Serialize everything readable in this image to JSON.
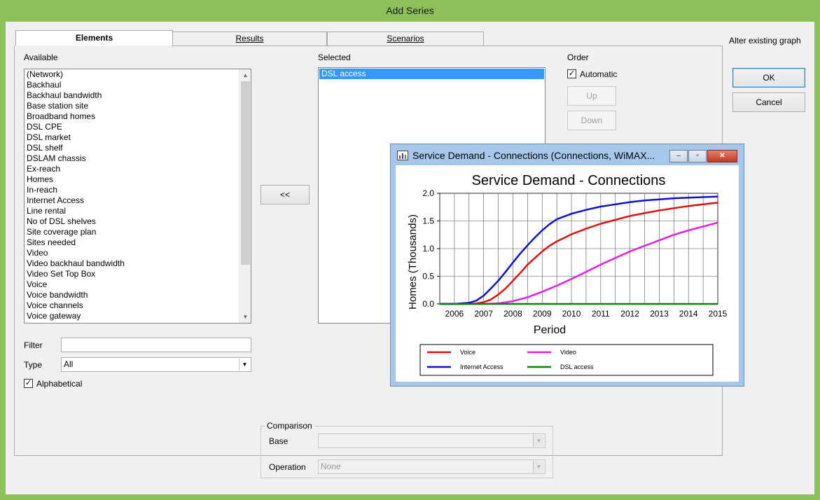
{
  "window": {
    "title": "Add Series"
  },
  "tabs": [
    {
      "label": "Elements",
      "active": true
    },
    {
      "label": "Results",
      "active": false
    },
    {
      "label": "Scenarios",
      "active": false
    }
  ],
  "alter_label": "Alter existing graph",
  "available": {
    "label": "Available",
    "items": [
      "(Network)",
      "Backhaul",
      "Backhaul bandwidth",
      "Base station site",
      "Broadband homes",
      "DSL CPE",
      "DSL market",
      "DSL shelf",
      "DSLAM chassis",
      "Ex-reach",
      "Homes",
      "In-reach",
      "Internet Access",
      "Line rental",
      "No of DSL shelves",
      "Site coverage plan",
      "Sites needed",
      "Video",
      "Video backhaul bandwidth",
      "Video Set Top Box",
      "Voice",
      "Voice bandwidth",
      "Voice channels",
      "Voice gateway"
    ]
  },
  "selected": {
    "label": "Selected",
    "items": [
      "DSL access"
    ]
  },
  "order": {
    "label": "Order",
    "automatic_label": "Automatic",
    "automatic_checked": true,
    "up_label": "Up",
    "down_label": "Down"
  },
  "move_button": {
    "label": "<<"
  },
  "buttons": {
    "ok": "OK",
    "cancel": "Cancel"
  },
  "filter": {
    "label": "Filter",
    "value": ""
  },
  "type": {
    "label": "Type",
    "value": "All"
  },
  "alphabetical": {
    "label": "Alphabetical",
    "checked": true
  },
  "comparison": {
    "title": "Comparison",
    "base_label": "Base",
    "base_value": "",
    "operation_label": "Operation",
    "operation_value": "None"
  },
  "chart_window": {
    "title": "Service Demand - Connections (Connections, WiMAX...",
    "controls": {
      "minimize": "–",
      "restore": "▫",
      "close": "✕"
    }
  },
  "chart_data": {
    "type": "line",
    "title": "Service Demand - Connections",
    "xlabel": "Period",
    "ylabel": "Homes (Thousands)",
    "ylim": [
      0,
      2.0
    ],
    "yticks": [
      "0.0",
      "0.5",
      "1.0",
      "1.5",
      "2.0"
    ],
    "xlim": [
      2006,
      2015.5
    ],
    "xticks": [
      "2006",
      "2007",
      "2008",
      "2009",
      "2010",
      "2011",
      "2012",
      "2013",
      "2014",
      "2015"
    ],
    "grid": true,
    "legend_position": "bottom",
    "series": [
      {
        "name": "Voice",
        "color": "#e01010",
        "x": [
          2006,
          2006.5,
          2007,
          2007.25,
          2007.5,
          2007.75,
          2008,
          2008.25,
          2008.5,
          2008.75,
          2009,
          2009.25,
          2009.5,
          2009.75,
          2010,
          2010.5,
          2011,
          2011.5,
          2012,
          2012.5,
          2013,
          2013.5,
          2014,
          2014.5,
          2015,
          2015.5
        ],
        "y": [
          0,
          0,
          0,
          0.01,
          0.03,
          0.08,
          0.17,
          0.28,
          0.42,
          0.56,
          0.71,
          0.83,
          0.95,
          1.05,
          1.13,
          1.26,
          1.36,
          1.45,
          1.52,
          1.59,
          1.64,
          1.69,
          1.73,
          1.77,
          1.8,
          1.83
        ]
      },
      {
        "name": "Video",
        "color": "#e020e0",
        "x": [
          2006,
          2007,
          2007.5,
          2008,
          2008.5,
          2009,
          2009.5,
          2010,
          2010.5,
          2011,
          2011.5,
          2012,
          2012.5,
          2013,
          2013.5,
          2014,
          2014.5,
          2015,
          2015.5
        ],
        "y": [
          0,
          0,
          0,
          0.01,
          0.05,
          0.12,
          0.22,
          0.33,
          0.45,
          0.58,
          0.71,
          0.83,
          0.95,
          1.05,
          1.15,
          1.25,
          1.33,
          1.4,
          1.47
        ]
      },
      {
        "name": "Internet Access",
        "color": "#1010d0",
        "x": [
          2006,
          2006.5,
          2007,
          2007.25,
          2007.5,
          2007.75,
          2008,
          2008.25,
          2008.5,
          2008.75,
          2009,
          2009.25,
          2009.5,
          2009.75,
          2010,
          2010.5,
          2011,
          2011.5,
          2012,
          2012.5,
          2013,
          2013.5,
          2014,
          2014.5,
          2015,
          2015.5
        ],
        "y": [
          0,
          0,
          0.02,
          0.06,
          0.15,
          0.28,
          0.42,
          0.58,
          0.75,
          0.91,
          1.06,
          1.2,
          1.33,
          1.44,
          1.53,
          1.63,
          1.7,
          1.76,
          1.8,
          1.84,
          1.87,
          1.89,
          1.91,
          1.92,
          1.93,
          1.94
        ]
      },
      {
        "name": "DSL access",
        "color": "#108010",
        "x": [
          2006,
          2015.5
        ],
        "y": [
          0,
          0
        ]
      }
    ]
  }
}
